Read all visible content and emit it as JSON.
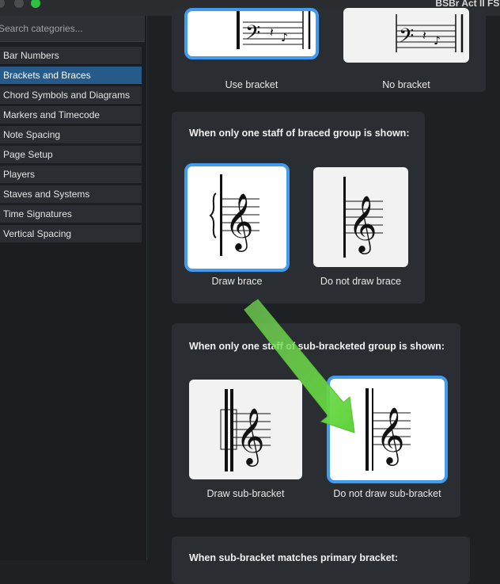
{
  "window": {
    "title": "BSBr Act II FS L"
  },
  "sidebar": {
    "search_placeholder": "Search categories...",
    "items": [
      {
        "label": "Bar Numbers",
        "selected": false
      },
      {
        "label": "Brackets and Braces",
        "selected": true
      },
      {
        "label": "Chord Symbols and Diagrams",
        "selected": false
      },
      {
        "label": "Markers and Timecode",
        "selected": false
      },
      {
        "label": "Note Spacing",
        "selected": false
      },
      {
        "label": "Page Setup",
        "selected": false
      },
      {
        "label": "Players",
        "selected": false
      },
      {
        "label": "Staves and Systems",
        "selected": false
      },
      {
        "label": "Time Signatures",
        "selected": false
      },
      {
        "label": "Vertical Spacing",
        "selected": false
      }
    ]
  },
  "sections": {
    "bracket": {
      "options": [
        {
          "label": "Use bracket",
          "selected": true
        },
        {
          "label": "No bracket",
          "selected": false
        }
      ]
    },
    "braced": {
      "title": "When only one staff of braced group is shown:",
      "options": [
        {
          "label": "Draw brace",
          "selected": true
        },
        {
          "label": "Do not draw brace",
          "selected": false
        }
      ]
    },
    "subbracketed": {
      "title": "When only one staff of sub-bracketed group is shown:",
      "options": [
        {
          "label": "Draw sub-bracket",
          "selected": false
        },
        {
          "label": "Do not draw sub-bracket",
          "selected": true
        }
      ]
    },
    "matches": {
      "title": "When sub-bracket matches primary bracket:"
    }
  },
  "annotation": {
    "arrow_color": "#5fd33a"
  }
}
